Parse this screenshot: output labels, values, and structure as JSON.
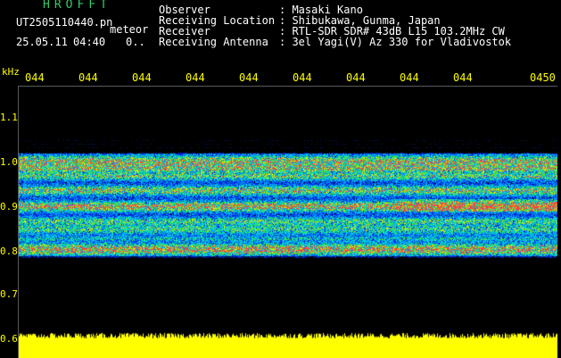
{
  "header": {
    "brand": "HROFFT",
    "filename": "UT2505110440.pn",
    "mode": "meteor",
    "date": "25.05.11",
    "time": "04:40",
    "pct": "0..",
    "info": [
      {
        "label": "Observer",
        "value": ": Masaki Kano"
      },
      {
        "label": "Receiving Location",
        "value": ": Shibukawa, Gunma, Japan"
      },
      {
        "label": "Receiver",
        "value": ": RTL-SDR SDR# 43dB L15 103.2MHz CW"
      },
      {
        "label": "Receiving Antenna",
        "value": ": 3el Yagi(V) Az 330 for Vladivostok"
      }
    ]
  },
  "axis": {
    "unit": "kHz",
    "time_ticks": [
      "044",
      "044",
      "044",
      "044",
      "044",
      "044",
      "044",
      "044",
      "044",
      "0450"
    ],
    "freq_ticks": [
      "1.1",
      "1.0",
      "0.9",
      "0.8",
      "0.7",
      "0.6"
    ]
  },
  "colors": {
    "accent_yellow": "#ffff00",
    "brand_green": "#33cc66",
    "text_white": "#ffffff",
    "background": "#000000"
  }
}
